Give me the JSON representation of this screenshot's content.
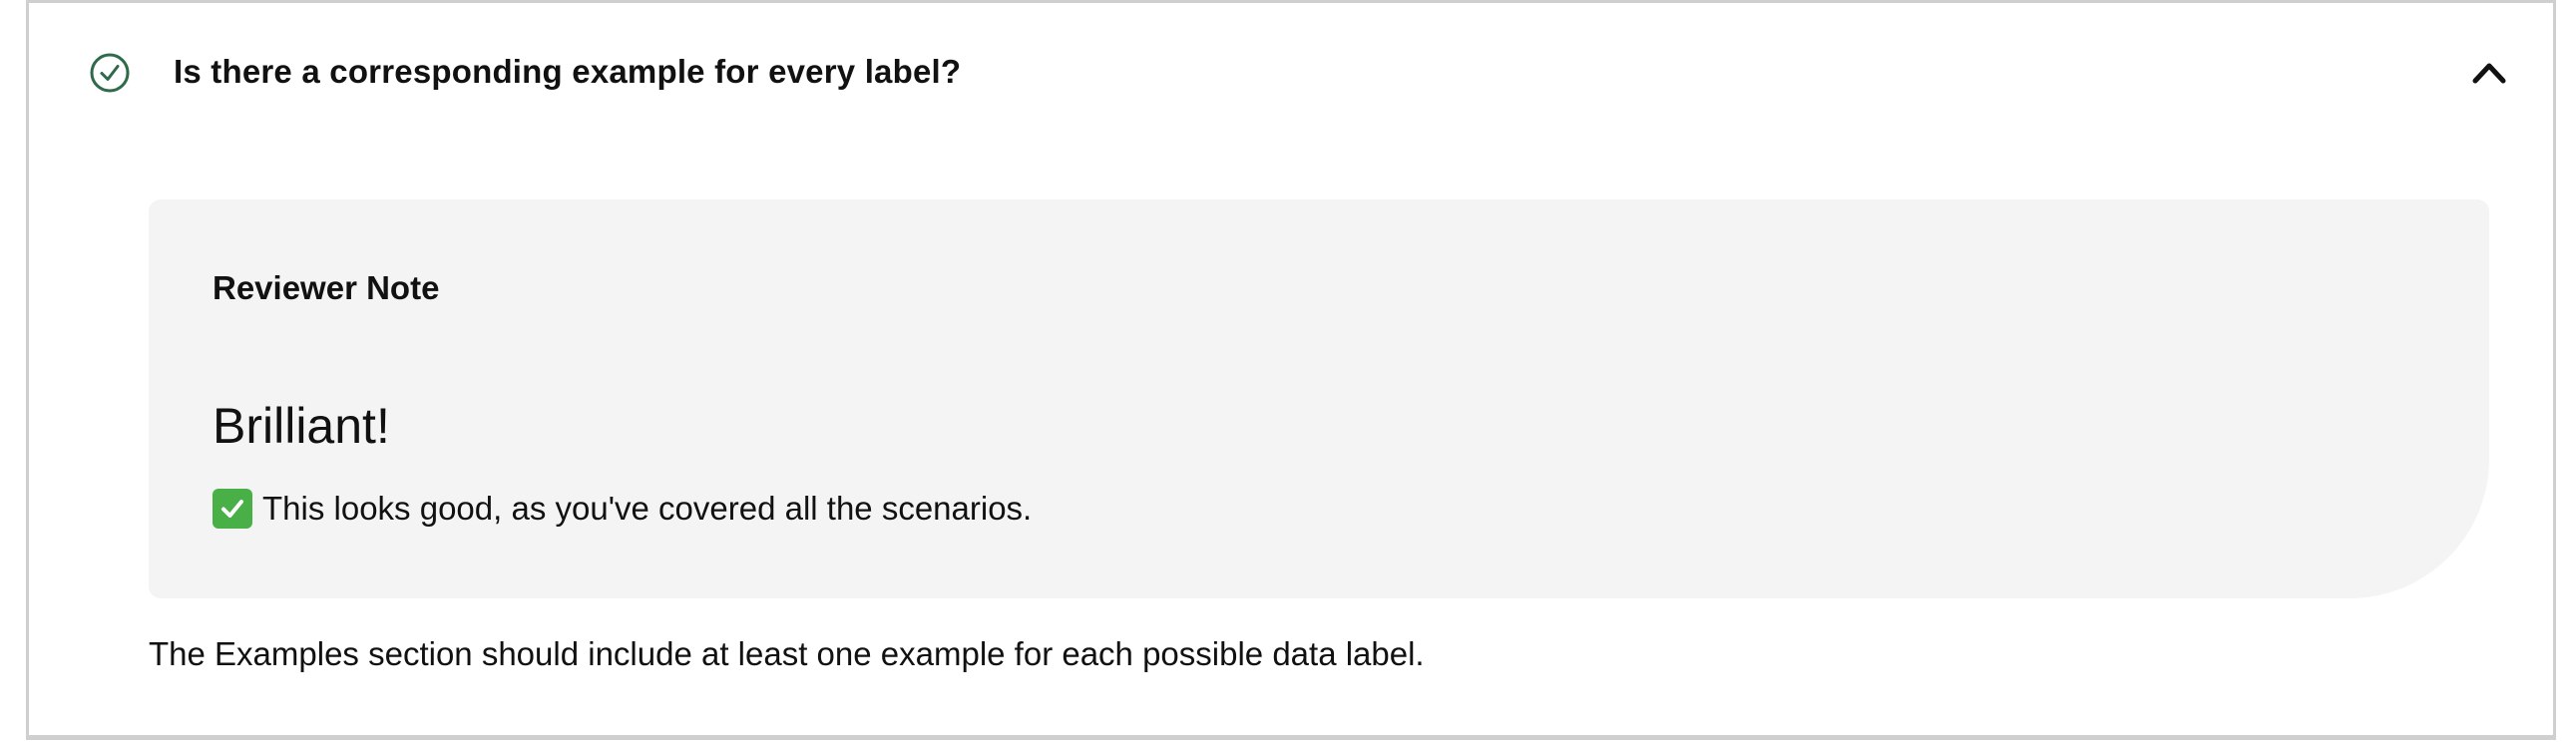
{
  "criterion": {
    "question": "Is there a corresponding example for every label?",
    "status_icon": "check-circle-icon",
    "status_color": "#2f6b4a",
    "toggle_icon": "chevron-up-icon",
    "expanded": true
  },
  "reviewer_note": {
    "heading": "Reviewer Note",
    "title": "Brilliant!",
    "comment_icon": "green-check-box-icon",
    "comment_icon_color": "#49b047",
    "comment": "This looks good, as you've covered all the scenarios."
  },
  "description": "The Examples section should include at least one example for each possible data label."
}
